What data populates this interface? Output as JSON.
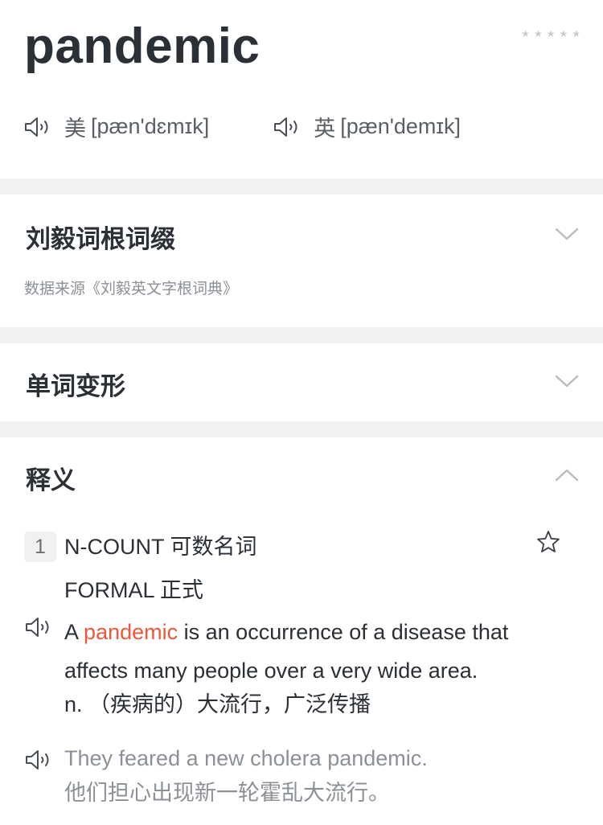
{
  "entry": {
    "word": "pandemic",
    "stars": 5
  },
  "pronunciations": [
    {
      "region": "美",
      "ipa": "[pæn'dɛmɪk]"
    },
    {
      "region": "英",
      "ipa": "[pæn'demɪk]"
    }
  ],
  "sections": {
    "roots": {
      "title": "刘毅词根词缀",
      "source": "数据来源《刘毅英文字根词典》"
    },
    "inflections": {
      "title": "单词变形"
    },
    "definitions": {
      "title": "释义"
    }
  },
  "sense": {
    "number": "1",
    "pos": "N-COUNT 可数名词",
    "register": "FORMAL 正式",
    "def_before": "A",
    "def_highlight": "pandemic",
    "def_after": "is an occurrence of a disease that",
    "def_line2": "affects many people over a very wide area.",
    "cn": "n. （疾病的）大流行，广泛传播"
  },
  "example": {
    "en": "They feared a new cholera pandemic.",
    "cn": "他们担心出现新一轮霍乱大流行。"
  },
  "colors": {
    "highlight": "#f0573a",
    "divider": "#f2f2f2",
    "text_primary": "#2b2f36",
    "text_secondary": "#5a5f66",
    "text_muted": "#8c9097"
  }
}
